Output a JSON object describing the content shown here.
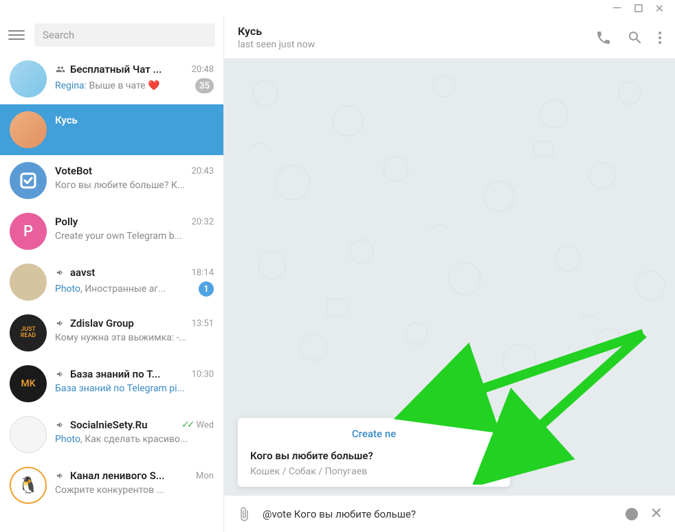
{
  "titlebar": {
    "min": "—",
    "max": "☐",
    "close": "✕"
  },
  "search": {
    "placeholder": "Search"
  },
  "chats": [
    {
      "title": "Бесплатный Чат ...",
      "time": "20:48",
      "sender": "Regina:",
      "preview": " Выше в чате ❤️",
      "badge": "35",
      "type": "group"
    },
    {
      "title": "Кусь",
      "selected": true
    },
    {
      "title": "VoteBot",
      "time": "20:43",
      "preview": "Кого вы любите больше?   К..."
    },
    {
      "title": "Polly",
      "time": "20:32",
      "preview": "Create your own Telegram b...",
      "letter": "P"
    },
    {
      "title": "aavst",
      "time": "18:14",
      "media": "Photo",
      "preview": ", Иностранные аг...",
      "badge": "1",
      "badgeBlue": true,
      "type": "channel"
    },
    {
      "title": "Zdislav Group",
      "time": "13:51",
      "preview": "Кому нужна эта выжимка:  -...",
      "type": "channel"
    },
    {
      "title": "База знаний по T...",
      "time": "10:30",
      "linkpreview": "База знаний по Telegram pi...",
      "type": "channel"
    },
    {
      "title": "SocialnieSety.Ru",
      "time": "Wed",
      "checks": true,
      "media": "Photo",
      "preview": ", Как сделать красиво...",
      "type": "channel"
    },
    {
      "title": "Канал ленивого S...",
      "time": "Mon",
      "preview": "Сожрите конкурентов ...",
      "type": "channel"
    }
  ],
  "header": {
    "title": "Кусь",
    "status": "last seen just now"
  },
  "popup": {
    "create": "Create ne",
    "question": "Кого вы любите больше?",
    "options": "Кошек / Собак / Попугаев"
  },
  "composer": {
    "text": "@vote Кого вы любите больше?"
  }
}
